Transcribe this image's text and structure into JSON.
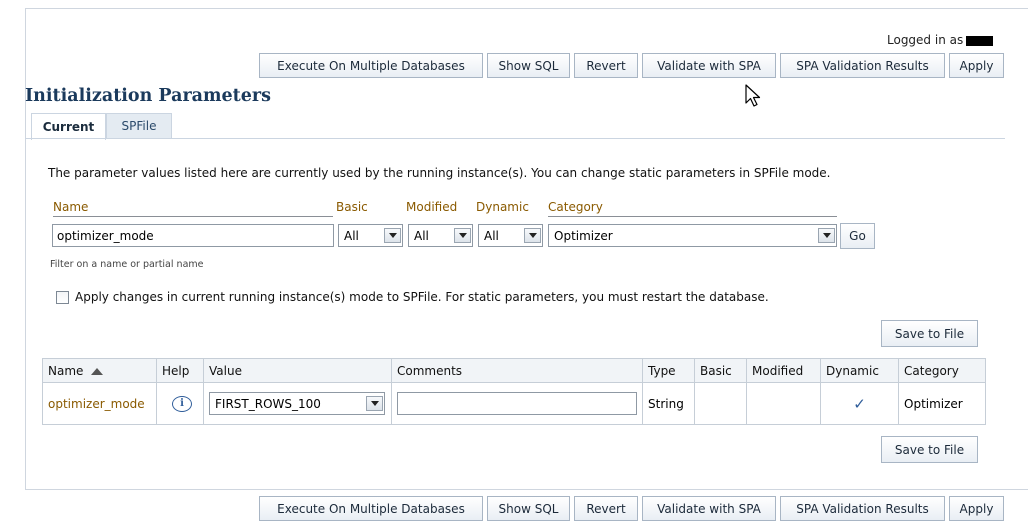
{
  "session": {
    "logged_in_label": "Logged in as"
  },
  "toolbar": {
    "execute_multi": "Execute On Multiple Databases",
    "show_sql": "Show SQL",
    "revert": "Revert",
    "validate_spa": "Validate with SPA",
    "spa_results": "SPA Validation Results",
    "apply": "Apply"
  },
  "page": {
    "title": "Initialization Parameters"
  },
  "tabs": [
    {
      "label": "Current",
      "active": true
    },
    {
      "label": "SPFile",
      "active": false
    }
  ],
  "intro_text": "The parameter values listed here are currently used by the running instance(s).  You can change static parameters in SPFile mode.",
  "filters": {
    "name_label": "Name",
    "name_value": "optimizer_mode",
    "name_hint": "Filter on a name or partial name",
    "basic_label": "Basic",
    "basic_value": "All",
    "modified_label": "Modified",
    "modified_value": "All",
    "dynamic_label": "Dynamic",
    "dynamic_value": "All",
    "category_label": "Category",
    "category_value": "Optimizer",
    "go_label": "Go"
  },
  "apply_spfile": {
    "checked": false,
    "label": "Apply changes in current running instance(s) mode to SPFile. For static parameters, you must restart the database."
  },
  "save_to_file": "Save to File",
  "table": {
    "columns": [
      "Name",
      "Help",
      "Value",
      "Comments",
      "Type",
      "Basic",
      "Modified",
      "Dynamic",
      "Category"
    ],
    "sorted_column": "Name",
    "rows": [
      {
        "name": "optimizer_mode",
        "help_icon": "info-icon",
        "value": "FIRST_ROWS_100",
        "comments": "",
        "type": "String",
        "basic": "",
        "modified": "",
        "dynamic": "✓",
        "category": "Optimizer"
      }
    ]
  },
  "colors": {
    "title": "#1b3a5c",
    "field_label": "#8a5a00",
    "link_blue": "#2f5d9a"
  }
}
